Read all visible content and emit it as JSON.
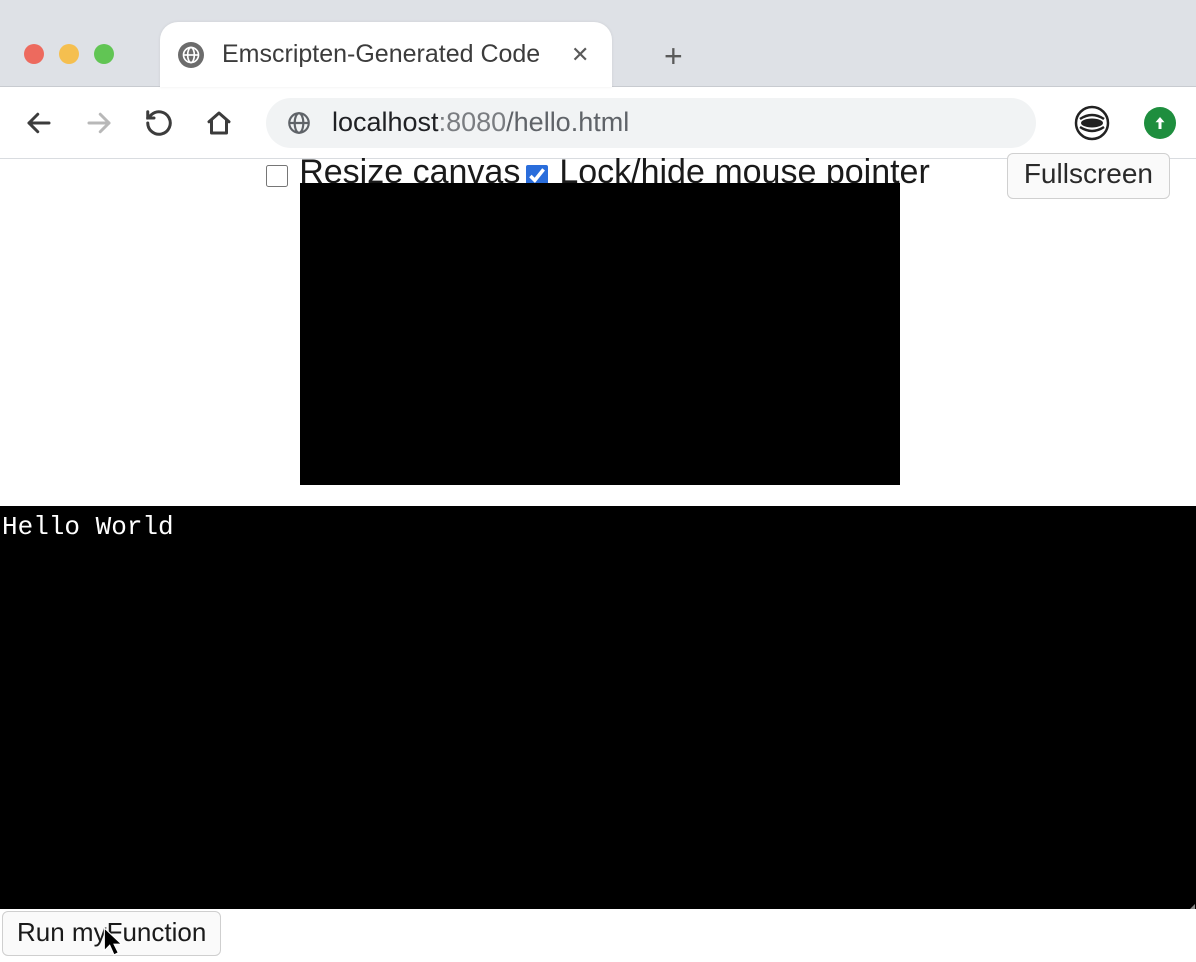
{
  "browser": {
    "tab_title": "Emscripten-Generated Code",
    "url_host": "localhost",
    "url_port": ":8080",
    "url_path": "/hello.html"
  },
  "controls": {
    "resize_label": "Resize canvas",
    "lock_label": "Lock/hide mouse pointer",
    "fullscreen_label": "Fullscreen",
    "resize_checked": false,
    "lock_checked": true
  },
  "console_output": "Hello World",
  "buttons": {
    "run_label": "Run myFunction"
  }
}
